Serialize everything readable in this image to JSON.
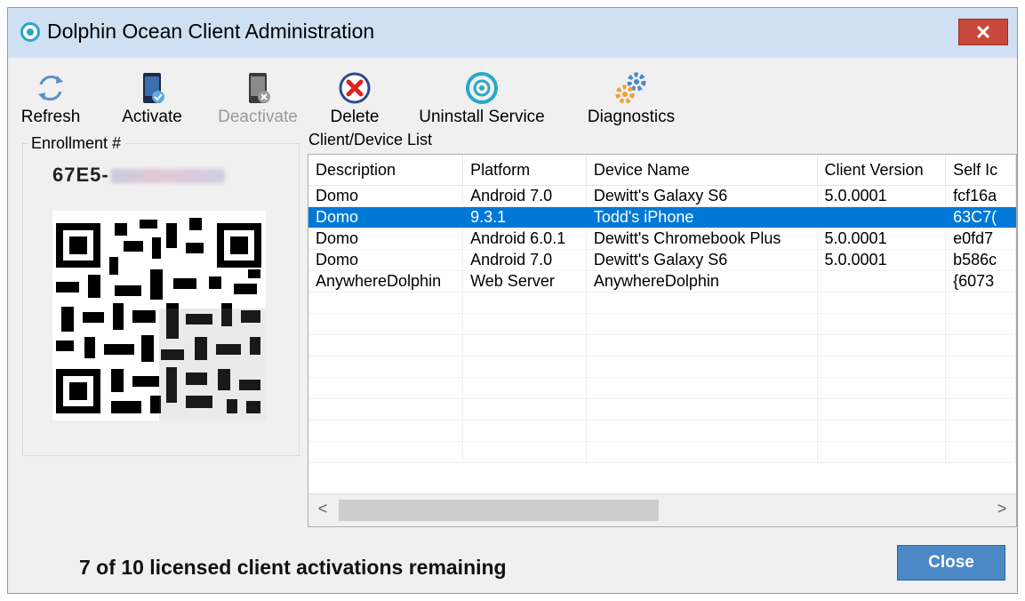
{
  "window": {
    "title": "Dolphin Ocean Client Administration",
    "close_glyph": "✕"
  },
  "toolbar": {
    "refresh": "Refresh",
    "activate": "Activate",
    "deactivate": "Deactivate",
    "delete": "Delete",
    "uninstall": "Uninstall Service",
    "diagnostics": "Diagnostics"
  },
  "enrollment": {
    "label": "Enrollment #",
    "value_prefix": "67E5-"
  },
  "client_list": {
    "label": "Client/Device List",
    "columns": [
      "Description",
      "Platform",
      "Device Name",
      "Client Version",
      "Self Ic"
    ],
    "rows": [
      [
        "Domo",
        "Android 7.0",
        "Dewitt's Galaxy S6",
        "5.0.0001",
        "fcf16a"
      ],
      [
        "Domo",
        "9.3.1",
        "Todd's iPhone",
        "",
        "63C7("
      ],
      [
        "Domo",
        "Android 6.0.1",
        "Dewitt's Chromebook Plus",
        "5.0.0001",
        "e0fd7"
      ],
      [
        "Domo",
        "Android 7.0",
        "Dewitt's Galaxy S6",
        "5.0.0001",
        "b586c"
      ],
      [
        "AnywhereDolphin",
        "Web Server",
        "AnywhereDolphin",
        "",
        "{6073"
      ]
    ],
    "selected_row": 1,
    "empty_rows": 8,
    "scroll_left": "<",
    "scroll_right": ">"
  },
  "status": "7 of 10 licensed client activations remaining",
  "close_button": "Close",
  "colors": {
    "selection": "#0078d7",
    "accent": "#2aa7c9",
    "close_btn": "#4b89c6",
    "title_close": "#c9483c"
  }
}
